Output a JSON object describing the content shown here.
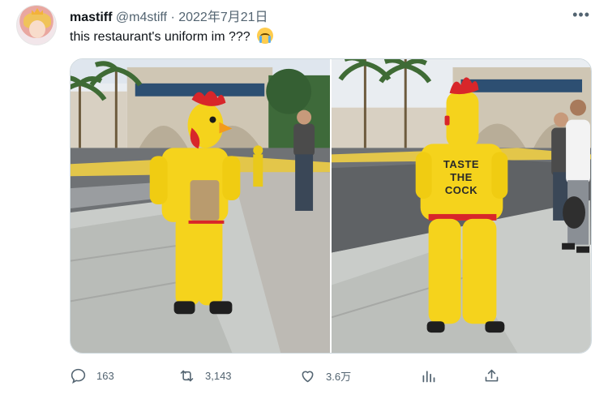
{
  "tweet": {
    "display_name": "mastiff",
    "handle": "@m4stiff",
    "separator": "·",
    "date": "2022年7月21日",
    "text": "this restaurant's uniform im ???",
    "emoji": "loudly-crying-face-emoji",
    "more_label": "•••"
  },
  "media": {
    "photo_right_shirt_text": [
      "TASTE",
      "THE",
      "COCK"
    ]
  },
  "actions": {
    "reply_count": "163",
    "retweet_count": "3,143",
    "like_count": "3.6万"
  },
  "colors": {
    "costume_yellow": "#f5d31c",
    "secondary_text": "#536471",
    "border": "#cfd9de"
  }
}
